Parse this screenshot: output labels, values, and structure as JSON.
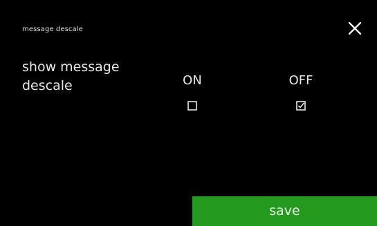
{
  "header": {
    "title": "message descale",
    "close_icon": "close-icon"
  },
  "setting": {
    "label": "show message descale",
    "options": [
      {
        "label": "ON",
        "checked": false
      },
      {
        "label": "OFF",
        "checked": true
      }
    ]
  },
  "footer": {
    "save_label": "save"
  },
  "colors": {
    "background": "#000000",
    "text": "#e8e8e8",
    "save_button": "#239a1e"
  }
}
